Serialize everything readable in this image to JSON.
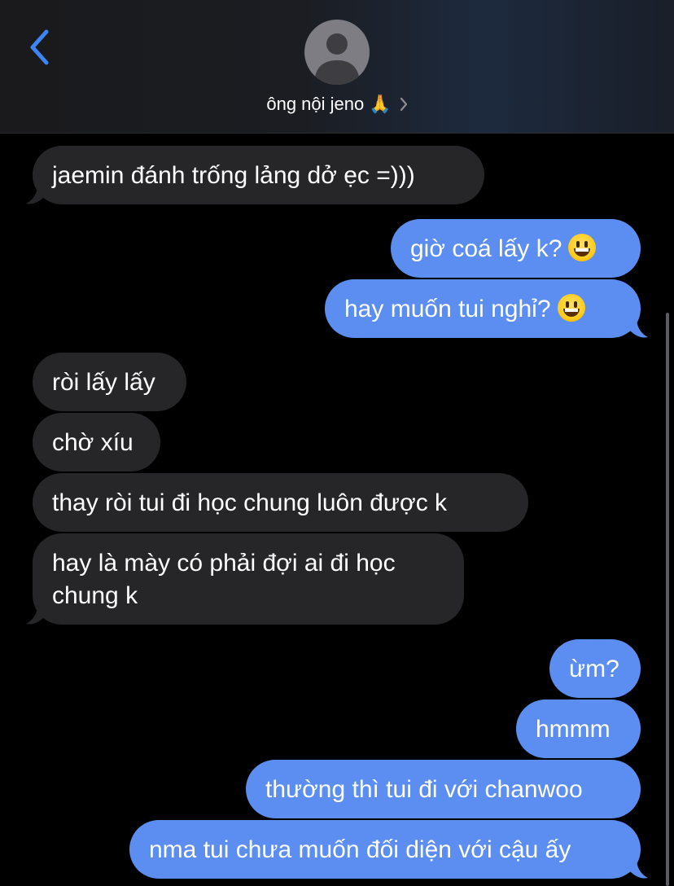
{
  "header": {
    "contact_name": "ông nội jeno",
    "contact_emoji": "🙏",
    "icons": {
      "back": "chevron-left-icon",
      "avatar": "person-silhouette-icon",
      "disclosure": "chevron-right-icon"
    }
  },
  "colors": {
    "incoming_bubble": "#262628",
    "outgoing_bubble": "#5b8ef0",
    "back_chevron": "#3d84f5",
    "background": "#000000"
  },
  "messages": [
    {
      "direction": "incoming",
      "text": "jaemin đánh trống lảng dở ẹc =)))"
    },
    {
      "direction": "outgoing",
      "text": "giờ coá lấy k?",
      "emoji": "grinning-face"
    },
    {
      "direction": "outgoing",
      "text": "hay muốn tui nghỉ?",
      "emoji": "grinning-face"
    },
    {
      "direction": "incoming",
      "text": "ròi lấy lấy"
    },
    {
      "direction": "incoming",
      "text": "chờ xíu"
    },
    {
      "direction": "incoming",
      "text": "thay ròi tui đi học chung luôn được k"
    },
    {
      "direction": "incoming",
      "text": "hay là mày có phải đợi ai đi học chung k"
    },
    {
      "direction": "outgoing",
      "text": "ừm?"
    },
    {
      "direction": "outgoing",
      "text": "hmmm"
    },
    {
      "direction": "outgoing",
      "text": "thường thì tui đi với chanwoo"
    },
    {
      "direction": "outgoing",
      "text": "nma tui chưa muốn đối diện với cậu ấy"
    }
  ]
}
